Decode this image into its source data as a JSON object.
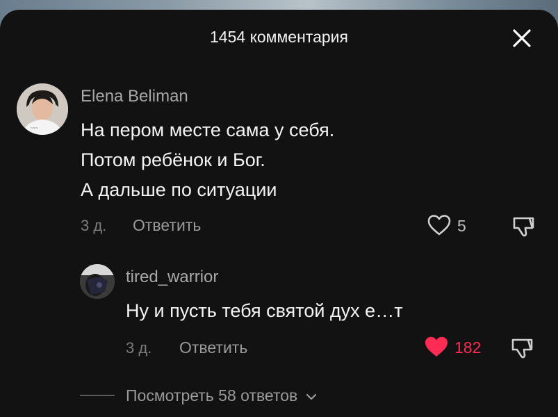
{
  "header": {
    "title": "1454 комментария"
  },
  "comment": {
    "username": "Elena Beliman",
    "lines": [
      "На пером месте сама у себя.",
      "Потом ребёнок и Бог.",
      "А дальше по ситуации"
    ],
    "time": "3 д.",
    "reply_label": "Ответить",
    "likes": "5"
  },
  "reply": {
    "username": "tired_warrior",
    "text": "Ну и пусть тебя святой дух е…т",
    "time": "3 д.",
    "reply_label": "Ответить",
    "likes": "182",
    "liked": true
  },
  "view_replies": {
    "label": "Посмотреть 58 ответов"
  },
  "colors": {
    "sheet": "#121212",
    "liked": "#fe2c55",
    "muted": "#9a9a9a"
  },
  "icons": [
    "close-icon",
    "heart-outline-icon",
    "heart-filled-icon",
    "dislike-icon",
    "chevron-down-icon"
  ]
}
